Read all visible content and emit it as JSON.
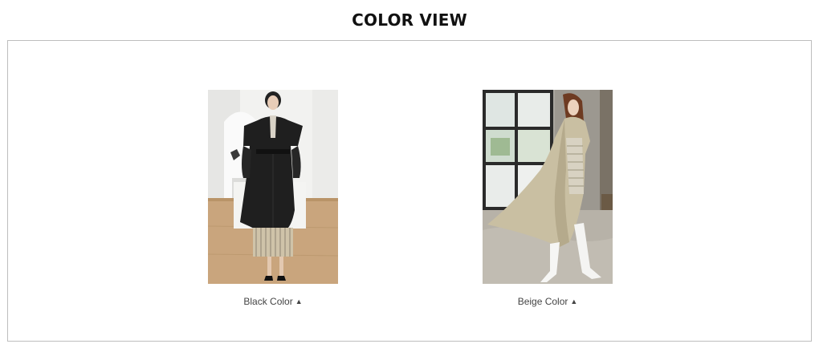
{
  "section": {
    "title": "COLOR VIEW"
  },
  "colors": [
    {
      "label": "Black Color",
      "arrow": "▲",
      "swatch": "#1f1f1f"
    },
    {
      "label": "Beige Color",
      "arrow": "▲",
      "swatch": "#cfc4a8"
    }
  ],
  "palette": {
    "border": "#bdbdbd",
    "background": "#ffffff",
    "text": "#444444"
  }
}
